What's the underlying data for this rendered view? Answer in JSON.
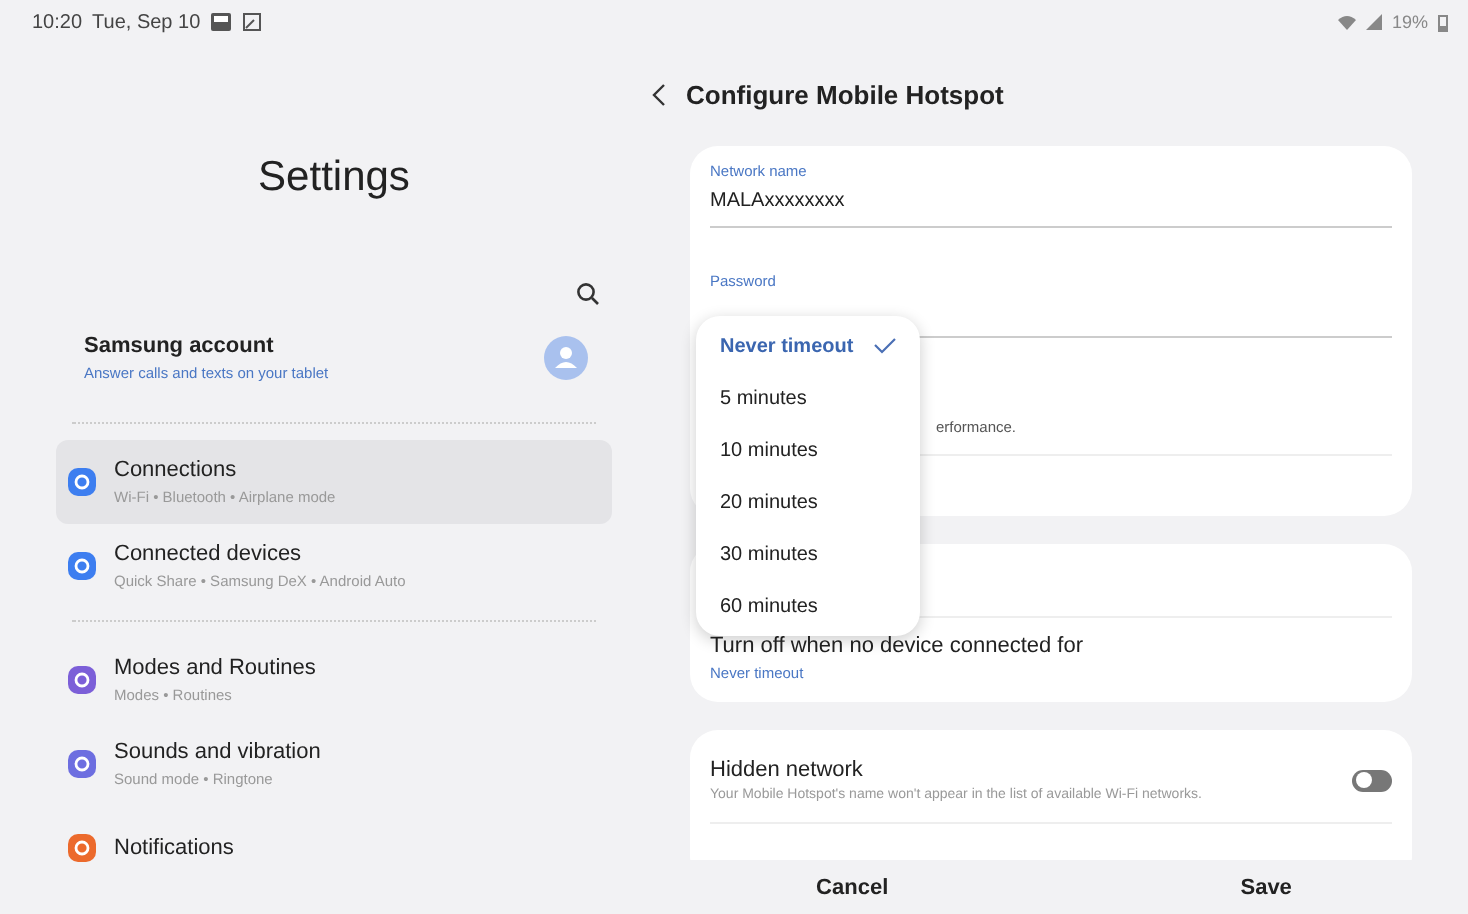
{
  "status_bar": {
    "time": "10:20",
    "date": "Tue, Sep 10",
    "battery": "19%"
  },
  "sidebar": {
    "title": "Settings",
    "account": {
      "name": "Samsung account",
      "subtitle": "Answer calls and texts on your tablet"
    },
    "groups": [
      [
        {
          "name": "Connections",
          "subtitle": "Wi-Fi • Bluetooth • Airplane mode",
          "selected": true,
          "color": "#3d7ef0"
        },
        {
          "name": "Connected devices",
          "subtitle": "Quick Share • Samsung DeX • Android Auto",
          "selected": false,
          "color": "#3d7ef0"
        }
      ],
      [
        {
          "name": "Modes and Routines",
          "subtitle": "Modes • Routines",
          "selected": false,
          "color": "#7c5fd8"
        },
        {
          "name": "Sounds and vibration",
          "subtitle": "Sound mode • Ringtone",
          "selected": false,
          "color": "#6d6ee0"
        },
        {
          "name": "Notifications",
          "selected": false,
          "color": "#ec6a2c"
        }
      ]
    ]
  },
  "panel": {
    "title": "Configure Mobile Hotspot",
    "fields": [
      {
        "label": "Network name",
        "value": "MALAxxxxxxxx"
      },
      {
        "label": "Password"
      }
    ],
    "covered_note": "erformance.",
    "timeout_menu": [
      {
        "label": "Never timeout",
        "selected": true
      },
      {
        "label": "5 minutes",
        "selected": false
      },
      {
        "label": "10 minutes",
        "selected": false
      },
      {
        "label": "20 minutes",
        "selected": false
      },
      {
        "label": "30 minutes",
        "selected": false
      },
      {
        "label": "60 minutes",
        "selected": false
      }
    ],
    "timeout": {
      "title": "Turn off when no device connected for",
      "value": "Never timeout"
    },
    "hidden_network": {
      "title": "Hidden network",
      "subtitle": "Your Mobile Hotspot's name won't appear in the list of available Wi-Fi networks.",
      "on": false
    }
  },
  "buttons": [
    "Cancel",
    "Save"
  ]
}
